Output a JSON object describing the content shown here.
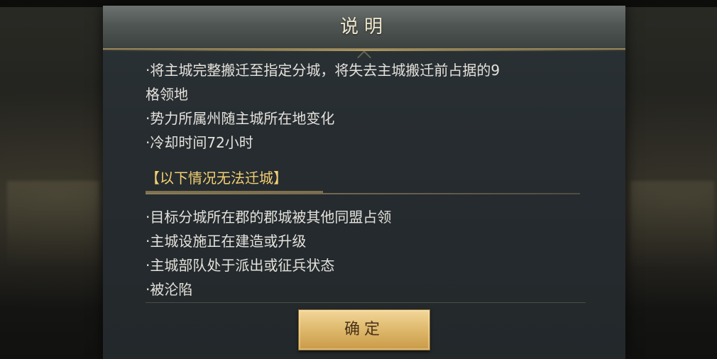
{
  "dialog": {
    "title": "说明",
    "intro_lines": [
      "·将主城完整搬迁至指定分城，将失去主城搬迁前占据的9",
      "格领地",
      "·势力所属州随主城所在地变化",
      "·冷却时间72小时"
    ],
    "section_title": "【以下情况无法迁城】",
    "conditions": [
      "·目标分城所在郡的郡城被其他同盟占领",
      "·主城设施正在建造或升级",
      "·主城部队处于派出或征兵状态",
      "·被沦陷"
    ],
    "confirm_label": "确定"
  },
  "colors": {
    "accent_gold": "#f2cf72",
    "button_gold": "#e0bb6f",
    "panel_bg": "#262c30",
    "text": "#e4e2dc"
  }
}
